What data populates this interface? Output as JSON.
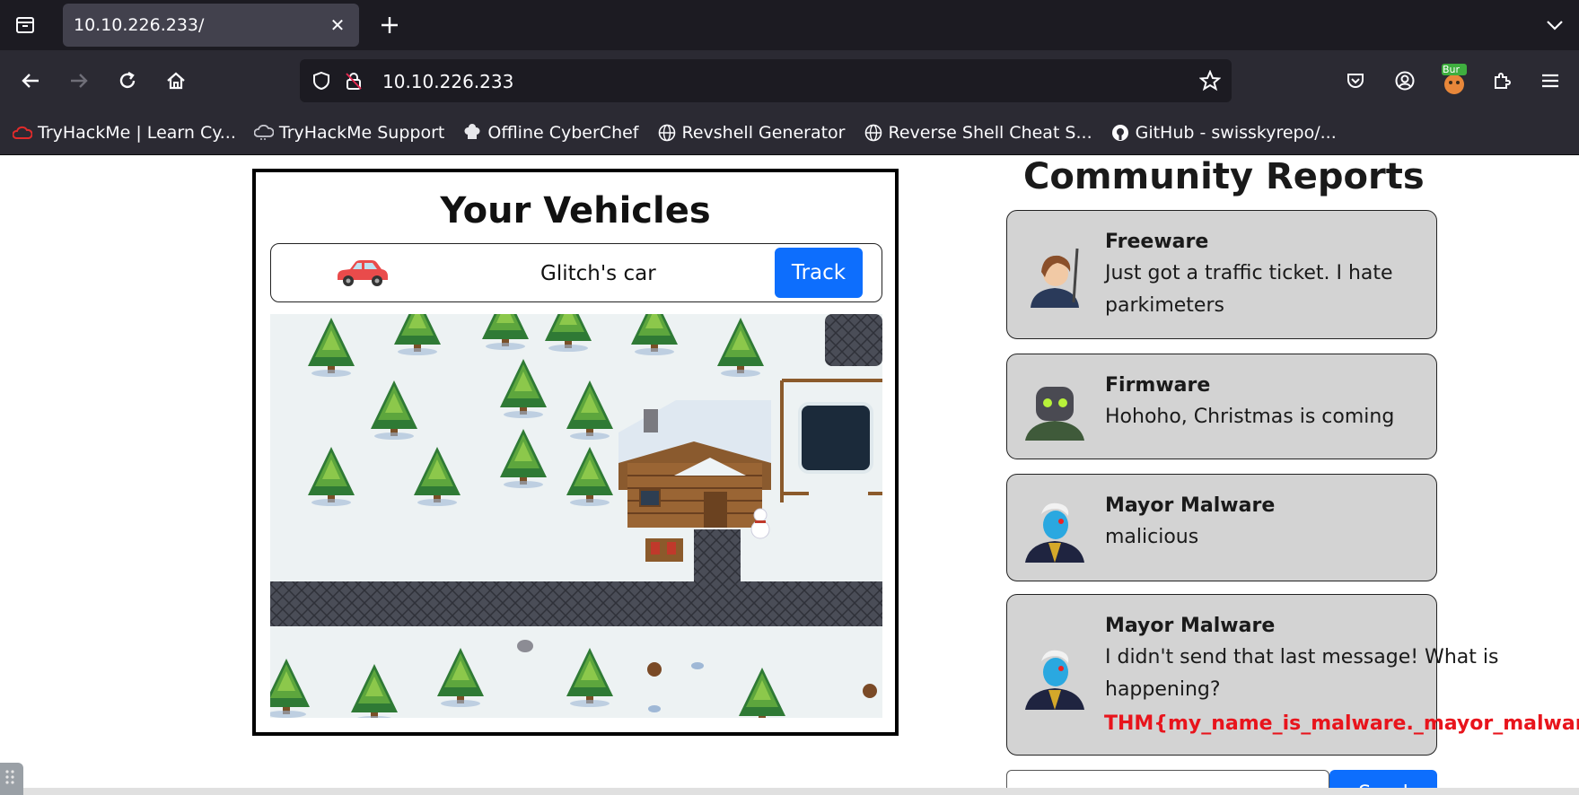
{
  "browser": {
    "tab_title": "10.10.226.233/",
    "url": "10.10.226.233",
    "burp_badge": "Bur",
    "bookmarks": [
      {
        "label": "TryHackMe | Learn Cy...",
        "icon": "tryhackme-icon"
      },
      {
        "label": "TryHackMe Support",
        "icon": "cloud-icon"
      },
      {
        "label": "Offline CyberChef",
        "icon": "chef-icon"
      },
      {
        "label": "Revshell Generator",
        "icon": "globe-icon"
      },
      {
        "label": "Reverse Shell Cheat S...",
        "icon": "globe-icon"
      },
      {
        "label": "GitHub - swisskyrepo/...",
        "icon": "github-icon"
      }
    ]
  },
  "vehicles": {
    "title": "Your Vehicles",
    "items": [
      {
        "name": "Glitch's car",
        "action": "Track",
        "icon": "car-icon"
      }
    ]
  },
  "reports": {
    "title": "Community Reports",
    "items": [
      {
        "author": "Freeware",
        "lines": [
          "Just got a traffic ticket. I hate",
          "parkimeters"
        ],
        "avatar": "freeware-avatar"
      },
      {
        "author": "Firmware",
        "lines": [
          "Hohoho, Christmas is coming"
        ],
        "avatar": "firmware-avatar"
      },
      {
        "author": "Mayor Malware",
        "lines": [
          "malicious"
        ],
        "avatar": "mayor-malware-avatar"
      },
      {
        "author": "Mayor Malware",
        "lines": [
          "I didn't send that last message! What is",
          "happening?"
        ],
        "flag": "THM{my_name_is_malware._mayor_malware}",
        "avatar": "mayor-malware-avatar"
      }
    ],
    "send_label": "Send",
    "message_value": ""
  },
  "colors": {
    "accent_blue": "#0d6efd",
    "flag_red": "#e8141c",
    "card_gray": "#d3d3d3",
    "chrome_dark": "#1c1b22",
    "chrome_toolbar": "#2b2a33"
  }
}
